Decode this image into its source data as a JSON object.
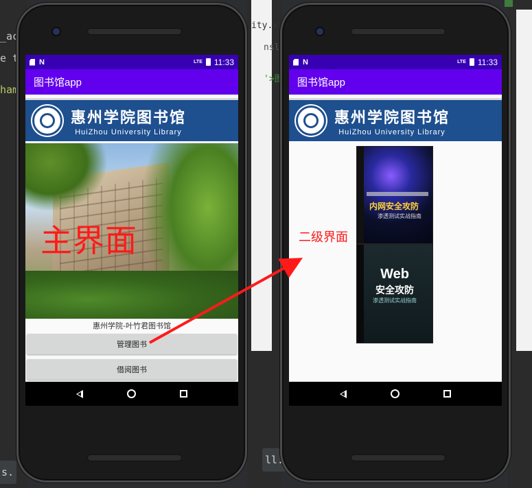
{
  "ide": {
    "left_fragments": [
      "_ac",
      "e tr",
      "ham"
    ],
    "center_fragments": [
      "ity.x",
      "nsla",
      "'>图"
    ],
    "bottom_left": "s.",
    "bottom_center": "ll."
  },
  "left_phone": {
    "status": {
      "time": "11:33",
      "lte": "LTE"
    },
    "app_title": "图书馆app",
    "banner": {
      "cn": "惠州学院图书馆",
      "en": "HuiZhou University Library"
    },
    "overlay_label": "主界面",
    "caption": "惠州学院-叶竹君图书馆",
    "buttons": {
      "manage": "管理图书",
      "borrow": "借阅图书"
    }
  },
  "right_phone": {
    "status": {
      "time": "11:33",
      "lte": "LTE"
    },
    "app_title": "图书馆app",
    "banner": {
      "cn": "惠州学院图书馆",
      "en": "HuiZhou University Library"
    },
    "overlay_label": "二级界面",
    "book1": {
      "title": "内网安全攻防",
      "subtitle": "渗透测试实战指南"
    },
    "book2": {
      "title": "Web",
      "subtitle": "安全攻防",
      "subtitle2": "渗透测试实战指南"
    }
  },
  "colors": {
    "status_bar": "#3700b3",
    "app_bar": "#6200ee",
    "banner": "#1e4f8f",
    "annotation": "#ff1a1a",
    "button": "#d6d7d7"
  },
  "icons": [
    "sd-card-icon",
    "n-notification-icon",
    "lte-icon",
    "battery-icon",
    "back-icon",
    "home-icon",
    "recents-icon",
    "library-logo-icon",
    "arrow-icon"
  ]
}
